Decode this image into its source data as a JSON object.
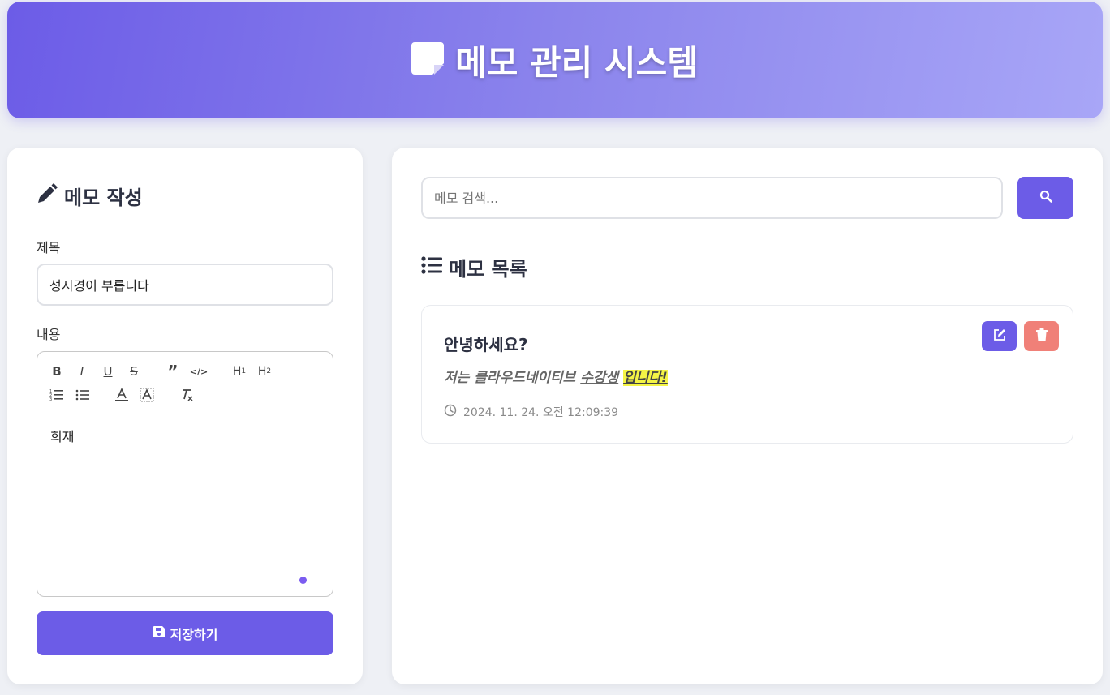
{
  "header": {
    "title": "메모 관리 시스템",
    "icon": "sticky-note-icon"
  },
  "editor_panel": {
    "heading": "메모 작성",
    "heading_icon": "pencil-icon",
    "title_label": "제목",
    "title_value": "성시경이 부릅니다",
    "content_label": "내용",
    "content_value": "희재",
    "toolbar": [
      "bold",
      "italic",
      "underline",
      "strikethrough",
      "blockquote",
      "code-block",
      "header-1",
      "header-2",
      "ordered-list",
      "bullet-list",
      "text-color",
      "background-color",
      "clear-format"
    ],
    "save_label": "저장하기"
  },
  "list_panel": {
    "search_placeholder": "메모 검색...",
    "heading": "메모 목록",
    "heading_icon": "list-icon",
    "memos": [
      {
        "title": "안녕하세요?",
        "content_plain1": "저는 ",
        "content_italic": "클라우드네이티브 ",
        "content_underlined": "수강생",
        "content_space": " ",
        "content_highlighted": "입니다!",
        "date": "2024. 11. 24. 오전 12:09:39"
      }
    ]
  },
  "colors": {
    "accent": "#6c5ce7",
    "delete": "#f08078",
    "highlight": "#f4f445"
  }
}
